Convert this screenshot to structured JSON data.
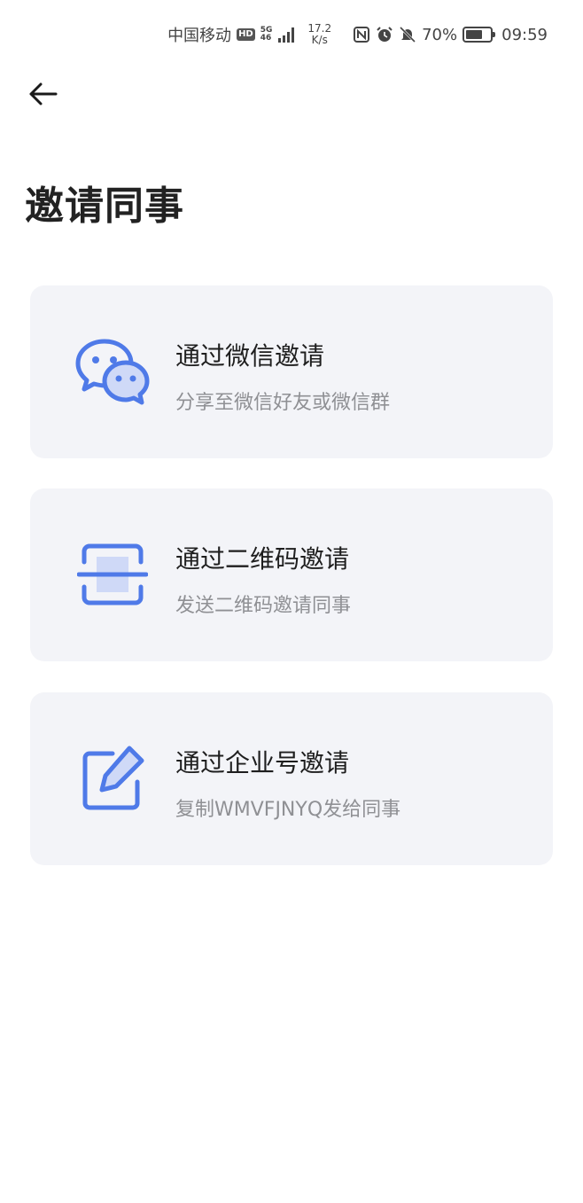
{
  "status_bar": {
    "carrier": "中国移动",
    "hd": "HD",
    "net_type_top": "5G",
    "net_type_bottom": "46",
    "speed_value": "17.2",
    "speed_unit": "K/s",
    "battery_percent": "70%",
    "battery_level": 0.7,
    "time": "09:59"
  },
  "header": {
    "title": "邀请同事"
  },
  "options": [
    {
      "title": "通过微信邀请",
      "subtitle": "分享至微信好友或微信群",
      "icon": "wechat-icon"
    },
    {
      "title": "通过二维码邀请",
      "subtitle": "发送二维码邀请同事",
      "icon": "qr-scan-icon"
    },
    {
      "title": "通过企业号邀请",
      "subtitle": "复制WMVFJNYQ发给同事",
      "icon": "edit-icon"
    }
  ],
  "colors": {
    "accent": "#4f7ae8",
    "accent_light": "#cfd9f7",
    "card_bg": "#f3f4f8"
  }
}
